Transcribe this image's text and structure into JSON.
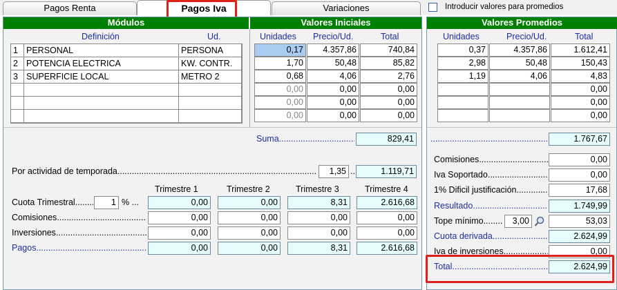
{
  "tabs": [
    "Pagos Renta",
    "Pagos Iva",
    "Variaciones"
  ],
  "promedios_checkbox": "Introducir valores para promedios",
  "modulos": {
    "title": "Módulos",
    "col_def": "Definición",
    "col_ud": "Ud.",
    "rows": [
      {
        "n": "1",
        "def": "PERSONAL",
        "ud": "PERSONA"
      },
      {
        "n": "2",
        "def": "POTENCIA ELECTRICA",
        "ud": "KW. CONTR."
      },
      {
        "n": "3",
        "def": "SUPERFICIE LOCAL",
        "ud": "METRO 2"
      }
    ]
  },
  "iniciales": {
    "title": "Valores Iniciales",
    "cols": [
      "Unidades",
      "Precio/Ud.",
      "Total"
    ],
    "rows": [
      [
        "0,17",
        "4.357,86",
        "740,84"
      ],
      [
        "1,70",
        "50,48",
        "85,82"
      ],
      [
        "0,68",
        "4,06",
        "2,76"
      ],
      [
        "0,00",
        "0,00",
        "0,00"
      ],
      [
        "0,00",
        "0,00",
        "0,00"
      ],
      [
        "0,00",
        "0,00",
        "0,00"
      ]
    ],
    "suma_label": "Suma",
    "suma": "829,41",
    "temporada_label": "Por actividad de temporada",
    "temporada_factor": "1,35",
    "temporada_total": "1.119,71"
  },
  "promedios": {
    "title": "Valores Promedios",
    "cols": [
      "Unidades",
      "Precio/Ud.",
      "Total"
    ],
    "rows": [
      [
        "0,37",
        "4.357,86",
        "1.612,41"
      ],
      [
        "2,98",
        "50,48",
        "150,43"
      ],
      [
        "1,19",
        "4,06",
        "4,83"
      ],
      [
        "",
        "",
        "0,00"
      ],
      [
        "",
        "",
        "0,00"
      ],
      [
        "",
        "",
        "0,00"
      ]
    ],
    "suma": "1.767,67",
    "items": [
      {
        "label": "Comisiones",
        "value": "0,00"
      },
      {
        "label": "Iva Soportado",
        "value": "0,00"
      },
      {
        "label": "1% Dificil justificación",
        "value": "17,68"
      },
      {
        "label": "Resultado",
        "value": "1.749,99"
      },
      {
        "label": "Tope mínimo",
        "factor": "3,00",
        "value": "53,03"
      },
      {
        "label": "Cuota derivada",
        "value": "2.624,99"
      },
      {
        "label": "Iva de inversiones",
        "value": "0,00"
      },
      {
        "label": "Total",
        "value": "2.624,99"
      }
    ]
  },
  "trimestres": {
    "headers": [
      "Trimestre 1",
      "Trimestre 2",
      "Trimestre 3",
      "Trimestre 4"
    ],
    "cuota_label": "Cuota Trimestral",
    "cuota_pct": "1",
    "pct_sign": "%",
    "rows": [
      {
        "label": "Cuota Trimestral",
        "values": [
          "0,00",
          "0,00",
          "8,31",
          "2.616,68"
        ]
      },
      {
        "label": "Comisiones",
        "values": [
          "0,00",
          "0,00",
          "0,00",
          "0,00"
        ]
      },
      {
        "label": "Inversiones",
        "values": [
          "0,00",
          "0,00",
          "0,00",
          "0,00"
        ]
      },
      {
        "label": "Pagos",
        "values": [
          "0,00",
          "0,00",
          "8,31",
          "2.616,68"
        ]
      }
    ]
  }
}
